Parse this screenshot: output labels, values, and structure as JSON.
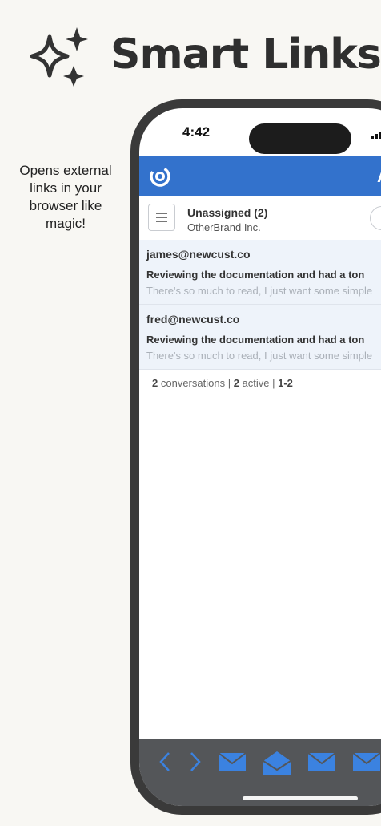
{
  "header": {
    "title": "Smart Links",
    "icon": "sparkles-icon"
  },
  "caption": {
    "line1": "Opens external",
    "line2": "links in your",
    "line3": "browser like",
    "line4": "magic!"
  },
  "phone": {
    "status_time": "4:42",
    "header_letter": "A",
    "brand_color": "#3372cc",
    "toolbar_color": "#545659",
    "mailbox": {
      "name": "Unassigned (2)",
      "org": "OtherBrand Inc."
    },
    "conversations": [
      {
        "from": "james@newcust.co",
        "subject": "Reviewing the documentation and had a ton",
        "preview": "There's so much to read, I just want some simple"
      },
      {
        "from": "fred@newcust.co",
        "subject": "Reviewing the documentation and had a ton",
        "preview": "There's so much to read, I just want some simple"
      }
    ],
    "summary": {
      "count": "2",
      "count_label": "conversations",
      "active": "2",
      "active_label": "active",
      "range": "1-2"
    },
    "toolbar_icons": [
      "chevron-left-icon",
      "chevron-right-icon",
      "envelope-icon",
      "envelope-open-icon",
      "envelope-icon",
      "envelope-icon"
    ]
  }
}
